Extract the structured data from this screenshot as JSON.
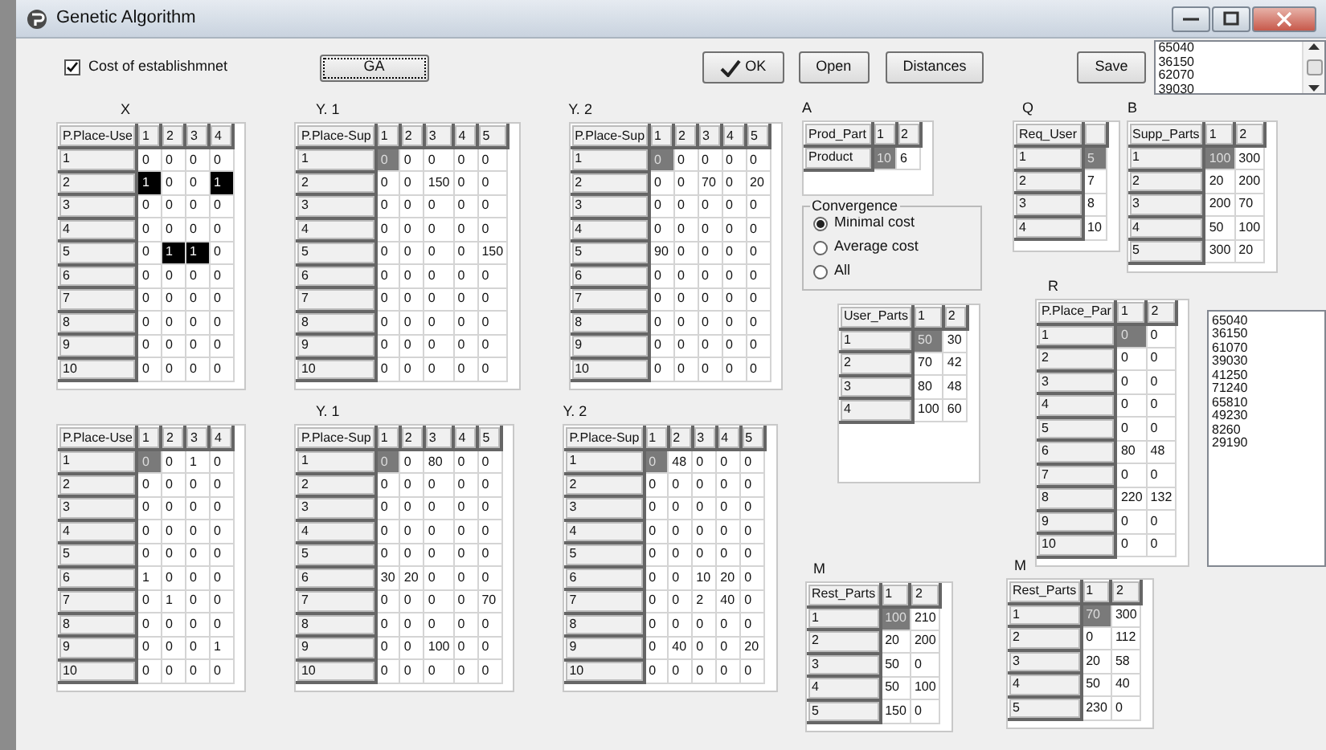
{
  "window": {
    "title": "Genetic Algorithm"
  },
  "toolbar": {
    "checkbox": {
      "label": "Cost of establishmnet",
      "checked": true
    },
    "buttons": [
      {
        "label": "GA",
        "kind": "focused"
      },
      {
        "label": "OK",
        "kind": "check"
      },
      {
        "label": "Open",
        "kind": "plain"
      },
      {
        "label": "Distances",
        "kind": "plain"
      },
      {
        "label": "Save",
        "kind": "plain"
      }
    ],
    "list": [
      "65040",
      "36150",
      "62070",
      "39030"
    ]
  },
  "left_grids": [
    {
      "caption": "X",
      "corner": "P.Place-Use",
      "columns": [
        "1",
        "2",
        "3",
        "4"
      ],
      "rows": [
        {
          "label": "1",
          "cells": [
            "0",
            "0",
            "0",
            "0"
          ],
          "focused": [
            false,
            false,
            false,
            false
          ],
          "black": [
            false,
            false,
            false,
            false
          ]
        },
        {
          "label": "2",
          "cells": [
            "1",
            "0",
            "0",
            "1"
          ],
          "focused": [
            false,
            false,
            false,
            false
          ],
          "black": [
            true,
            false,
            false,
            true
          ]
        },
        {
          "label": "3",
          "cells": [
            "0",
            "0",
            "0",
            "0"
          ],
          "focused": [
            false,
            false,
            false,
            false
          ],
          "black": [
            false,
            false,
            false,
            false
          ]
        },
        {
          "label": "4",
          "cells": [
            "0",
            "0",
            "0",
            "0"
          ],
          "focused": [
            false,
            false,
            false,
            false
          ],
          "black": [
            false,
            false,
            false,
            false
          ]
        },
        {
          "label": "5",
          "cells": [
            "0",
            "1",
            "1",
            "0"
          ],
          "focused": [
            false,
            false,
            false,
            false
          ],
          "black": [
            false,
            true,
            true,
            false
          ]
        },
        {
          "label": "6",
          "cells": [
            "0",
            "0",
            "0",
            "0"
          ],
          "focused": [
            false,
            false,
            false,
            false
          ],
          "black": [
            false,
            false,
            false,
            false
          ]
        },
        {
          "label": "7",
          "cells": [
            "0",
            "0",
            "0",
            "0"
          ],
          "focused": [
            false,
            false,
            false,
            false
          ],
          "black": [
            false,
            false,
            false,
            false
          ]
        },
        {
          "label": "8",
          "cells": [
            "0",
            "0",
            "0",
            "0"
          ],
          "focused": [
            false,
            false,
            false,
            false
          ],
          "black": [
            false,
            false,
            false,
            false
          ]
        },
        {
          "label": "9",
          "cells": [
            "0",
            "0",
            "0",
            "0"
          ],
          "focused": [
            false,
            false,
            false,
            false
          ],
          "black": [
            false,
            false,
            false,
            false
          ]
        },
        {
          "label": "10",
          "cells": [
            "0",
            "0",
            "0",
            "0"
          ],
          "focused": [
            false,
            false,
            false,
            false
          ],
          "black": [
            false,
            false,
            false,
            false
          ]
        }
      ]
    },
    {
      "caption": "Y. 1",
      "corner": "P.Place-Sup",
      "columns": [
        "1",
        "2",
        "3",
        "4",
        "5"
      ],
      "rows": [
        {
          "label": "1",
          "cells": [
            "0",
            "0",
            "0",
            "0",
            "0"
          ],
          "focused": [
            true,
            false,
            false,
            false,
            false
          ],
          "black": [
            false,
            false,
            false,
            false,
            false
          ]
        },
        {
          "label": "2",
          "cells": [
            "0",
            "0",
            "150",
            "0",
            "0"
          ],
          "focused": [
            false,
            false,
            false,
            false,
            false
          ],
          "black": [
            false,
            false,
            false,
            false,
            false
          ]
        },
        {
          "label": "3",
          "cells": [
            "0",
            "0",
            "0",
            "0",
            "0"
          ],
          "focused": [
            false,
            false,
            false,
            false,
            false
          ],
          "black": [
            false,
            false,
            false,
            false,
            false
          ]
        },
        {
          "label": "4",
          "cells": [
            "0",
            "0",
            "0",
            "0",
            "0"
          ],
          "focused": [
            false,
            false,
            false,
            false,
            false
          ],
          "black": [
            false,
            false,
            false,
            false,
            false
          ]
        },
        {
          "label": "5",
          "cells": [
            "0",
            "0",
            "0",
            "0",
            "150"
          ],
          "focused": [
            false,
            false,
            false,
            false,
            false
          ],
          "black": [
            false,
            false,
            false,
            false,
            false
          ]
        },
        {
          "label": "6",
          "cells": [
            "0",
            "0",
            "0",
            "0",
            "0"
          ],
          "focused": [
            false,
            false,
            false,
            false,
            false
          ],
          "black": [
            false,
            false,
            false,
            false,
            false
          ]
        },
        {
          "label": "7",
          "cells": [
            "0",
            "0",
            "0",
            "0",
            "0"
          ],
          "focused": [
            false,
            false,
            false,
            false,
            false
          ],
          "black": [
            false,
            false,
            false,
            false,
            false
          ]
        },
        {
          "label": "8",
          "cells": [
            "0",
            "0",
            "0",
            "0",
            "0"
          ],
          "focused": [
            false,
            false,
            false,
            false,
            false
          ],
          "black": [
            false,
            false,
            false,
            false,
            false
          ]
        },
        {
          "label": "9",
          "cells": [
            "0",
            "0",
            "0",
            "0",
            "0"
          ],
          "focused": [
            false,
            false,
            false,
            false,
            false
          ],
          "black": [
            false,
            false,
            false,
            false,
            false
          ]
        },
        {
          "label": "10",
          "cells": [
            "0",
            "0",
            "0",
            "0",
            "0"
          ],
          "focused": [
            false,
            false,
            false,
            false,
            false
          ],
          "black": [
            false,
            false,
            false,
            false,
            false
          ]
        }
      ]
    },
    {
      "caption": "Y. 2",
      "corner": "P.Place-Sup",
      "columns": [
        "1",
        "2",
        "3",
        "4",
        "5"
      ],
      "rows": [
        {
          "label": "1",
          "cells": [
            "0",
            "0",
            "0",
            "0",
            "0"
          ],
          "focused": [
            true,
            false,
            false,
            false,
            false
          ],
          "black": [
            false,
            false,
            false,
            false,
            false
          ]
        },
        {
          "label": "2",
          "cells": [
            "0",
            "0",
            "70",
            "0",
            "20"
          ],
          "focused": [
            false,
            false,
            false,
            false,
            false
          ],
          "black": [
            false,
            false,
            false,
            false,
            false
          ]
        },
        {
          "label": "3",
          "cells": [
            "0",
            "0",
            "0",
            "0",
            "0"
          ],
          "focused": [
            false,
            false,
            false,
            false,
            false
          ],
          "black": [
            false,
            false,
            false,
            false,
            false
          ]
        },
        {
          "label": "4",
          "cells": [
            "0",
            "0",
            "0",
            "0",
            "0"
          ],
          "focused": [
            false,
            false,
            false,
            false,
            false
          ],
          "black": [
            false,
            false,
            false,
            false,
            false
          ]
        },
        {
          "label": "5",
          "cells": [
            "90",
            "0",
            "0",
            "0",
            "0"
          ],
          "focused": [
            false,
            false,
            false,
            false,
            false
          ],
          "black": [
            false,
            false,
            false,
            false,
            false
          ]
        },
        {
          "label": "6",
          "cells": [
            "0",
            "0",
            "0",
            "0",
            "0"
          ],
          "focused": [
            false,
            false,
            false,
            false,
            false
          ],
          "black": [
            false,
            false,
            false,
            false,
            false
          ]
        },
        {
          "label": "7",
          "cells": [
            "0",
            "0",
            "0",
            "0",
            "0"
          ],
          "focused": [
            false,
            false,
            false,
            false,
            false
          ],
          "black": [
            false,
            false,
            false,
            false,
            false
          ]
        },
        {
          "label": "8",
          "cells": [
            "0",
            "0",
            "0",
            "0",
            "0"
          ],
          "focused": [
            false,
            false,
            false,
            false,
            false
          ],
          "black": [
            false,
            false,
            false,
            false,
            false
          ]
        },
        {
          "label": "9",
          "cells": [
            "0",
            "0",
            "0",
            "0",
            "0"
          ],
          "focused": [
            false,
            false,
            false,
            false,
            false
          ],
          "black": [
            false,
            false,
            false,
            false,
            false
          ]
        },
        {
          "label": "10",
          "cells": [
            "0",
            "0",
            "0",
            "0",
            "0"
          ],
          "focused": [
            false,
            false,
            false,
            false,
            false
          ],
          "black": [
            false,
            false,
            false,
            false,
            false
          ]
        }
      ]
    },
    {
      "corner": "P.Place-Use",
      "columns": [
        "1",
        "2",
        "3",
        "4"
      ],
      "rows": [
        {
          "label": "1",
          "cells": [
            "0",
            "0",
            "1",
            "0"
          ],
          "focused": [
            true,
            false,
            false,
            false
          ],
          "black": [
            false,
            false,
            false,
            false
          ]
        },
        {
          "label": "2",
          "cells": [
            "0",
            "0",
            "0",
            "0"
          ],
          "focused": [
            false,
            false,
            false,
            false
          ],
          "black": [
            false,
            false,
            false,
            false
          ]
        },
        {
          "label": "3",
          "cells": [
            "0",
            "0",
            "0",
            "0"
          ],
          "focused": [
            false,
            false,
            false,
            false
          ],
          "black": [
            false,
            false,
            false,
            false
          ]
        },
        {
          "label": "4",
          "cells": [
            "0",
            "0",
            "0",
            "0"
          ],
          "focused": [
            false,
            false,
            false,
            false
          ],
          "black": [
            false,
            false,
            false,
            false
          ]
        },
        {
          "label": "5",
          "cells": [
            "0",
            "0",
            "0",
            "0"
          ],
          "focused": [
            false,
            false,
            false,
            false
          ],
          "black": [
            false,
            false,
            false,
            false
          ]
        },
        {
          "label": "6",
          "cells": [
            "1",
            "0",
            "0",
            "0"
          ],
          "focused": [
            false,
            false,
            false,
            false
          ],
          "black": [
            false,
            false,
            false,
            false
          ]
        },
        {
          "label": "7",
          "cells": [
            "0",
            "1",
            "0",
            "0"
          ],
          "focused": [
            false,
            false,
            false,
            false
          ],
          "black": [
            false,
            false,
            false,
            false
          ]
        },
        {
          "label": "8",
          "cells": [
            "0",
            "0",
            "0",
            "0"
          ],
          "focused": [
            false,
            false,
            false,
            false
          ],
          "black": [
            false,
            false,
            false,
            false
          ]
        },
        {
          "label": "9",
          "cells": [
            "0",
            "0",
            "0",
            "1"
          ],
          "focused": [
            false,
            false,
            false,
            false
          ],
          "black": [
            false,
            false,
            false,
            false
          ]
        },
        {
          "label": "10",
          "cells": [
            "0",
            "0",
            "0",
            "0"
          ],
          "focused": [
            false,
            false,
            false,
            false
          ],
          "black": [
            false,
            false,
            false,
            false
          ]
        }
      ]
    },
    {
      "caption": "Y. 1",
      "corner": "P.Place-Sup",
      "columns": [
        "1",
        "2",
        "3",
        "4",
        "5"
      ],
      "rows": [
        {
          "label": "1",
          "cells": [
            "0",
            "0",
            "80",
            "0",
            "0"
          ],
          "focused": [
            true,
            false,
            false,
            false,
            false
          ],
          "black": [
            false,
            false,
            false,
            false,
            false
          ]
        },
        {
          "label": "2",
          "cells": [
            "0",
            "0",
            "0",
            "0",
            "0"
          ],
          "focused": [
            false,
            false,
            false,
            false,
            false
          ],
          "black": [
            false,
            false,
            false,
            false,
            false
          ]
        },
        {
          "label": "3",
          "cells": [
            "0",
            "0",
            "0",
            "0",
            "0"
          ],
          "focused": [
            false,
            false,
            false,
            false,
            false
          ],
          "black": [
            false,
            false,
            false,
            false,
            false
          ]
        },
        {
          "label": "4",
          "cells": [
            "0",
            "0",
            "0",
            "0",
            "0"
          ],
          "focused": [
            false,
            false,
            false,
            false,
            false
          ],
          "black": [
            false,
            false,
            false,
            false,
            false
          ]
        },
        {
          "label": "5",
          "cells": [
            "0",
            "0",
            "0",
            "0",
            "0"
          ],
          "focused": [
            false,
            false,
            false,
            false,
            false
          ],
          "black": [
            false,
            false,
            false,
            false,
            false
          ]
        },
        {
          "label": "6",
          "cells": [
            "30",
            "20",
            "0",
            "0",
            "0"
          ],
          "focused": [
            false,
            false,
            false,
            false,
            false
          ],
          "black": [
            false,
            false,
            false,
            false,
            false
          ]
        },
        {
          "label": "7",
          "cells": [
            "0",
            "0",
            "0",
            "0",
            "70"
          ],
          "focused": [
            false,
            false,
            false,
            false,
            false
          ],
          "black": [
            false,
            false,
            false,
            false,
            false
          ]
        },
        {
          "label": "8",
          "cells": [
            "0",
            "0",
            "0",
            "0",
            "0"
          ],
          "focused": [
            false,
            false,
            false,
            false,
            false
          ],
          "black": [
            false,
            false,
            false,
            false,
            false
          ]
        },
        {
          "label": "9",
          "cells": [
            "0",
            "0",
            "100",
            "0",
            "0"
          ],
          "focused": [
            false,
            false,
            false,
            false,
            false
          ],
          "black": [
            false,
            false,
            false,
            false,
            false
          ]
        },
        {
          "label": "10",
          "cells": [
            "0",
            "0",
            "0",
            "0",
            "0"
          ],
          "focused": [
            false,
            false,
            false,
            false,
            false
          ],
          "black": [
            false,
            false,
            false,
            false,
            false
          ]
        }
      ]
    },
    {
      "caption": "Y. 2",
      "corner": "P.Place-Sup",
      "columns": [
        "1",
        "2",
        "3",
        "4",
        "5"
      ],
      "rows": [
        {
          "label": "1",
          "cells": [
            "0",
            "48",
            "0",
            "0",
            "0"
          ],
          "focused": [
            true,
            false,
            false,
            false,
            false
          ],
          "black": [
            false,
            false,
            false,
            false,
            false
          ]
        },
        {
          "label": "2",
          "cells": [
            "0",
            "0",
            "0",
            "0",
            "0"
          ],
          "focused": [
            false,
            false,
            false,
            false,
            false
          ],
          "black": [
            false,
            false,
            false,
            false,
            false
          ]
        },
        {
          "label": "3",
          "cells": [
            "0",
            "0",
            "0",
            "0",
            "0"
          ],
          "focused": [
            false,
            false,
            false,
            false,
            false
          ],
          "black": [
            false,
            false,
            false,
            false,
            false
          ]
        },
        {
          "label": "4",
          "cells": [
            "0",
            "0",
            "0",
            "0",
            "0"
          ],
          "focused": [
            false,
            false,
            false,
            false,
            false
          ],
          "black": [
            false,
            false,
            false,
            false,
            false
          ]
        },
        {
          "label": "5",
          "cells": [
            "0",
            "0",
            "0",
            "0",
            "0"
          ],
          "focused": [
            false,
            false,
            false,
            false,
            false
          ],
          "black": [
            false,
            false,
            false,
            false,
            false
          ]
        },
        {
          "label": "6",
          "cells": [
            "0",
            "0",
            "10",
            "20",
            "0"
          ],
          "focused": [
            false,
            false,
            false,
            false,
            false
          ],
          "black": [
            false,
            false,
            false,
            false,
            false
          ]
        },
        {
          "label": "7",
          "cells": [
            "0",
            "0",
            "2",
            "40",
            "0"
          ],
          "focused": [
            false,
            false,
            false,
            false,
            false
          ],
          "black": [
            false,
            false,
            false,
            false,
            false
          ]
        },
        {
          "label": "8",
          "cells": [
            "0",
            "0",
            "0",
            "0",
            "0"
          ],
          "focused": [
            false,
            false,
            false,
            false,
            false
          ],
          "black": [
            false,
            false,
            false,
            false,
            false
          ]
        },
        {
          "label": "9",
          "cells": [
            "0",
            "40",
            "0",
            "0",
            "20"
          ],
          "focused": [
            false,
            false,
            false,
            false,
            false
          ],
          "black": [
            false,
            false,
            false,
            false,
            false
          ]
        },
        {
          "label": "10",
          "cells": [
            "0",
            "0",
            "0",
            "0",
            "0"
          ],
          "focused": [
            false,
            false,
            false,
            false,
            false
          ],
          "black": [
            false,
            false,
            false,
            false,
            false
          ]
        }
      ]
    }
  ],
  "prod_part": {
    "caption": "A",
    "corner": "Prod_Part",
    "columns": [
      "1",
      "2"
    ],
    "rows": [
      {
        "label": "Product",
        "cells": [
          "10",
          "6"
        ],
        "focused": [
          true,
          false
        ],
        "black": [
          false,
          false
        ]
      }
    ]
  },
  "convergence": {
    "title": "Convergence",
    "options": [
      {
        "label": "Minimal cost",
        "selected": true
      },
      {
        "label": "Average cost",
        "selected": false
      },
      {
        "label": "All",
        "selected": false
      }
    ]
  },
  "req_user": {
    "caption": "Q",
    "corner": "Req_User",
    "rows": [
      {
        "label": "1",
        "cells": [
          "5"
        ],
        "focused": [
          true
        ],
        "black": [
          false
        ]
      },
      {
        "label": "2",
        "cells": [
          "7"
        ],
        "focused": [
          false
        ],
        "black": [
          false
        ]
      },
      {
        "label": "3",
        "cells": [
          "8"
        ],
        "focused": [
          false
        ],
        "black": [
          false
        ]
      },
      {
        "label": "4",
        "cells": [
          "10"
        ],
        "focused": [
          false
        ],
        "black": [
          false
        ]
      }
    ]
  },
  "supp_parts": {
    "caption": "B",
    "corner": "Supp_Parts",
    "columns": [
      "1",
      "2"
    ],
    "rows": [
      {
        "label": "1",
        "cells": [
          "100",
          "300"
        ],
        "focused": [
          true,
          false
        ],
        "black": [
          false,
          false
        ]
      },
      {
        "label": "2",
        "cells": [
          "20",
          "200"
        ],
        "focused": [
          false,
          false
        ],
        "black": [
          false,
          false
        ]
      },
      {
        "label": "3",
        "cells": [
          "200",
          "70"
        ],
        "focused": [
          false,
          false
        ],
        "black": [
          false,
          false
        ]
      },
      {
        "label": "4",
        "cells": [
          "50",
          "100"
        ],
        "focused": [
          false,
          false
        ],
        "black": [
          false,
          false
        ]
      },
      {
        "label": "5",
        "cells": [
          "300",
          "20"
        ],
        "focused": [
          false,
          false
        ],
        "black": [
          false,
          false
        ]
      }
    ]
  },
  "user_parts": {
    "corner": "User_Parts",
    "columns": [
      "1",
      "2"
    ],
    "rows": [
      {
        "label": "1",
        "cells": [
          "50",
          "30"
        ],
        "focused": [
          true,
          false
        ],
        "black": [
          false,
          false
        ]
      },
      {
        "label": "2",
        "cells": [
          "70",
          "42"
        ],
        "focused": [
          false,
          false
        ],
        "black": [
          false,
          false
        ]
      },
      {
        "label": "3",
        "cells": [
          "80",
          "48"
        ],
        "focused": [
          false,
          false
        ],
        "black": [
          false,
          false
        ]
      },
      {
        "label": "4",
        "cells": [
          "100",
          "60"
        ],
        "focused": [
          false,
          false
        ],
        "black": [
          false,
          false
        ]
      }
    ]
  },
  "place_part": {
    "caption": "R",
    "corner": "P.Place_Par",
    "columns": [
      "1",
      "2"
    ],
    "rows": [
      {
        "label": "1",
        "cells": [
          "0",
          "0"
        ],
        "focused": [
          true,
          false
        ],
        "black": [
          false,
          false
        ]
      },
      {
        "label": "2",
        "cells": [
          "0",
          "0"
        ],
        "focused": [
          false,
          false
        ],
        "black": [
          false,
          false
        ]
      },
      {
        "label": "3",
        "cells": [
          "0",
          "0"
        ],
        "focused": [
          false,
          false
        ],
        "black": [
          false,
          false
        ]
      },
      {
        "label": "4",
        "cells": [
          "0",
          "0"
        ],
        "focused": [
          false,
          false
        ],
        "black": [
          false,
          false
        ]
      },
      {
        "label": "5",
        "cells": [
          "0",
          "0"
        ],
        "focused": [
          false,
          false
        ],
        "black": [
          false,
          false
        ]
      },
      {
        "label": "6",
        "cells": [
          "80",
          "48"
        ],
        "focused": [
          false,
          false
        ],
        "black": [
          false,
          false
        ]
      },
      {
        "label": "7",
        "cells": [
          "0",
          "0"
        ],
        "focused": [
          false,
          false
        ],
        "black": [
          false,
          false
        ]
      },
      {
        "label": "8",
        "cells": [
          "220",
          "132"
        ],
        "focused": [
          false,
          false
        ],
        "black": [
          false,
          false
        ]
      },
      {
        "label": "9",
        "cells": [
          "0",
          "0"
        ],
        "focused": [
          false,
          false
        ],
        "black": [
          false,
          false
        ]
      },
      {
        "label": "10",
        "cells": [
          "0",
          "0"
        ],
        "focused": [
          false,
          false
        ],
        "black": [
          false,
          false
        ]
      }
    ]
  },
  "results": [
    "65040",
    "36150",
    "61070",
    "39030",
    "41250",
    "71240",
    "65810",
    "49230",
    "8260",
    "29190"
  ],
  "rest_parts": [
    {
      "caption": "M",
      "corner": "Rest_Parts",
      "columns": [
        "1",
        "2"
      ],
      "rows": [
        {
          "label": "1",
          "cells": [
            "100",
            "210"
          ],
          "focused": [
            true,
            false
          ],
          "black": [
            false,
            false
          ]
        },
        {
          "label": "2",
          "cells": [
            "20",
            "200"
          ],
          "focused": [
            false,
            false
          ],
          "black": [
            false,
            false
          ]
        },
        {
          "label": "3",
          "cells": [
            "50",
            "0"
          ],
          "focused": [
            false,
            false
          ],
          "black": [
            false,
            false
          ]
        },
        {
          "label": "4",
          "cells": [
            "50",
            "100"
          ],
          "focused": [
            false,
            false
          ],
          "black": [
            false,
            false
          ]
        },
        {
          "label": "5",
          "cells": [
            "150",
            "0"
          ],
          "focused": [
            false,
            false
          ],
          "black": [
            false,
            false
          ]
        }
      ]
    },
    {
      "caption": "M",
      "corner": "Rest_Parts",
      "columns": [
        "1",
        "2"
      ],
      "rows": [
        {
          "label": "1",
          "cells": [
            "70",
            "300"
          ],
          "focused": [
            true,
            false
          ],
          "black": [
            false,
            false
          ]
        },
        {
          "label": "2",
          "cells": [
            "0",
            "112"
          ],
          "focused": [
            false,
            false
          ],
          "black": [
            false,
            false
          ]
        },
        {
          "label": "3",
          "cells": [
            "20",
            "58"
          ],
          "focused": [
            false,
            false
          ],
          "black": [
            false,
            false
          ]
        },
        {
          "label": "4",
          "cells": [
            "50",
            "40"
          ],
          "focused": [
            false,
            false
          ],
          "black": [
            false,
            false
          ]
        },
        {
          "label": "5",
          "cells": [
            "230",
            "0"
          ],
          "focused": [
            false,
            false
          ],
          "black": [
            false,
            false
          ]
        }
      ]
    }
  ]
}
